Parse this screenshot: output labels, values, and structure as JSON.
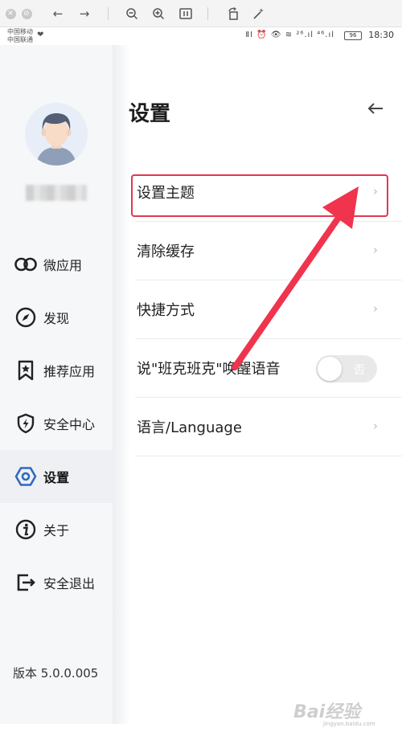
{
  "status_bar": {
    "carrier_1": "中国移动",
    "carrier_2": "中国联通",
    "indicators": "ⅡⅠ ⏰ 👁 ≋ ²⁶.ıl ⁴⁶.ıl",
    "battery": "96",
    "time": "18:30"
  },
  "sidebar": {
    "items": [
      {
        "label": "微应用",
        "icon": "link-icon"
      },
      {
        "label": "发现",
        "icon": "compass-icon"
      },
      {
        "label": "推荐应用",
        "icon": "bookmark-star-icon"
      },
      {
        "label": "安全中心",
        "icon": "shield-bolt-icon"
      },
      {
        "label": "设置",
        "icon": "hexagon-gear-icon",
        "active": true
      },
      {
        "label": "关于",
        "icon": "info-icon"
      },
      {
        "label": "安全退出",
        "icon": "logout-icon"
      }
    ],
    "version": "版本 5.0.0.005"
  },
  "main": {
    "title": "设置",
    "rows": [
      {
        "label": "设置主题",
        "type": "chevron"
      },
      {
        "label": "清除缓存",
        "type": "chevron"
      },
      {
        "label": "快捷方式",
        "type": "chevron"
      },
      {
        "label": "说\"班克班克\"唤醒语音",
        "type": "toggle",
        "toggle_text": "否"
      },
      {
        "label": "语言/Language",
        "type": "chevron"
      }
    ]
  },
  "annotation": {
    "highlight_color": "#e0384f",
    "arrow_color": "#f0344e"
  },
  "watermark": {
    "text": "Bai经验",
    "url": "jingyan.baidu.com"
  },
  "colors": {
    "accent": "#2f6bbd",
    "sidebar_bg": "#f6f7f9",
    "active_bg": "#eef0f4"
  }
}
